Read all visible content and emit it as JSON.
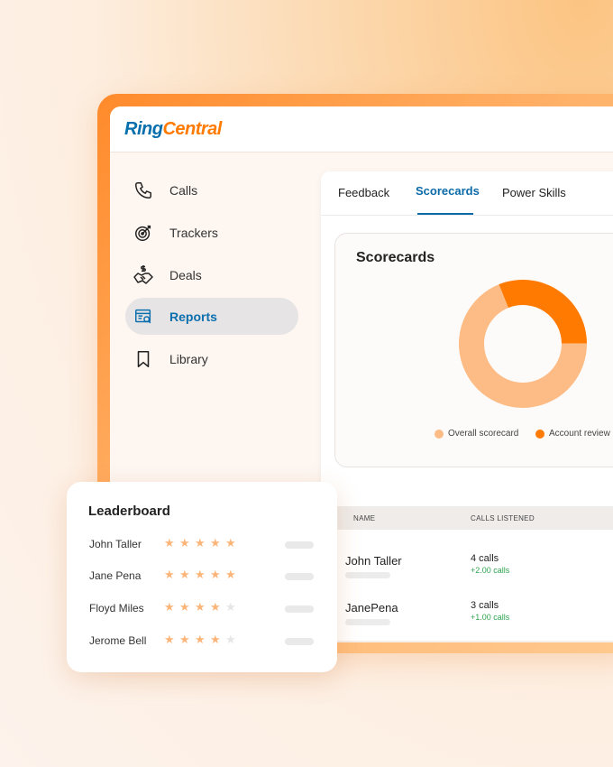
{
  "brand": {
    "ring": "Ring",
    "central": "Central"
  },
  "sidebar": {
    "items": [
      {
        "label": "Calls",
        "icon": "phone-icon",
        "active": false
      },
      {
        "label": "Trackers",
        "icon": "target-icon",
        "active": false
      },
      {
        "label": "Deals",
        "icon": "handshake-dollar-icon",
        "active": false
      },
      {
        "label": "Reports",
        "icon": "report-search-icon",
        "active": true
      },
      {
        "label": "Library",
        "icon": "bookmark-icon",
        "active": false
      }
    ]
  },
  "tabs": [
    {
      "label": "Feedback",
      "active": false
    },
    {
      "label": "Scorecards",
      "active": true
    },
    {
      "label": "Power Skills",
      "active": false
    }
  ],
  "scorecard": {
    "title": "Scorecards",
    "chart_data": {
      "type": "pie",
      "donut": true,
      "series": [
        {
          "name": "Overall scorecard",
          "value": 0.69,
          "color": "#fdbc85"
        },
        {
          "name": "Account review",
          "value": 0.31,
          "color": "#ff7a00"
        }
      ]
    }
  },
  "table": {
    "headers": {
      "name": "NAME",
      "calls": "CALLS LISTENED"
    },
    "rows": [
      {
        "name": "John Taller",
        "calls": "4 calls",
        "delta": "+2.00 calls"
      },
      {
        "name": "JanePena",
        "calls": "3 calls",
        "delta": "+1.00 calls"
      }
    ]
  },
  "leaderboard": {
    "title": "Leaderboard",
    "rows": [
      {
        "name": "John Taller",
        "stars": 5
      },
      {
        "name": "Jane Pena",
        "stars": 5
      },
      {
        "name": "Floyd Miles",
        "stars": 4
      },
      {
        "name": "Jerome Bell",
        "stars": 4
      }
    ]
  },
  "colors": {
    "accent": "#ff7a00",
    "brand_blue": "#066fac",
    "star": "#fbb579",
    "star_empty": "#e6e6e6"
  }
}
